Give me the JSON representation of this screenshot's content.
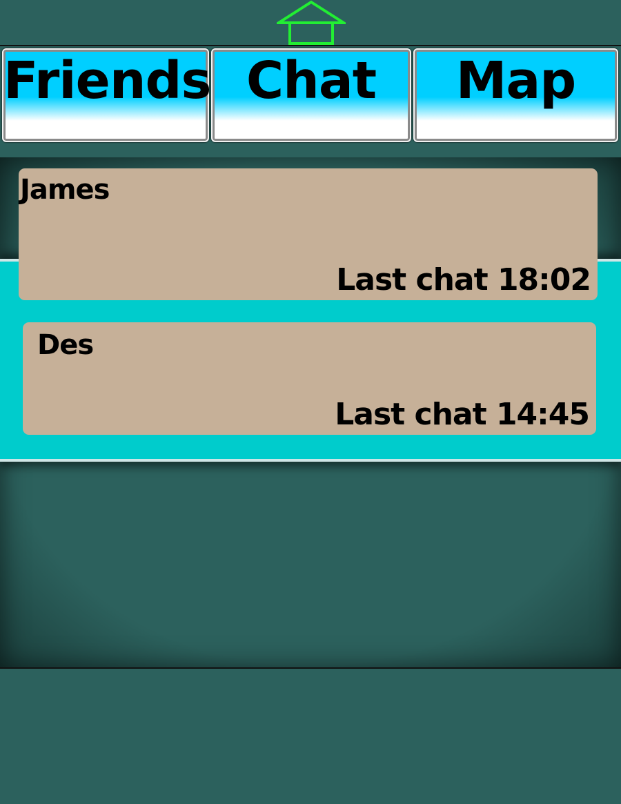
{
  "app": {
    "home_icon": "home-icon",
    "accent_color": "#00cfff",
    "background_color": "#2c615d",
    "band_color": "#00cccc",
    "card_color": "#c6b098",
    "home_icon_color": "#22ee33"
  },
  "tabs": [
    {
      "label": "Friends"
    },
    {
      "label": "Chat"
    },
    {
      "label": "Map"
    }
  ],
  "friends": [
    {
      "name": "James",
      "last_chat": "Last chat 18:02"
    },
    {
      "name": "Des",
      "last_chat": "Last chat 14:45"
    }
  ]
}
